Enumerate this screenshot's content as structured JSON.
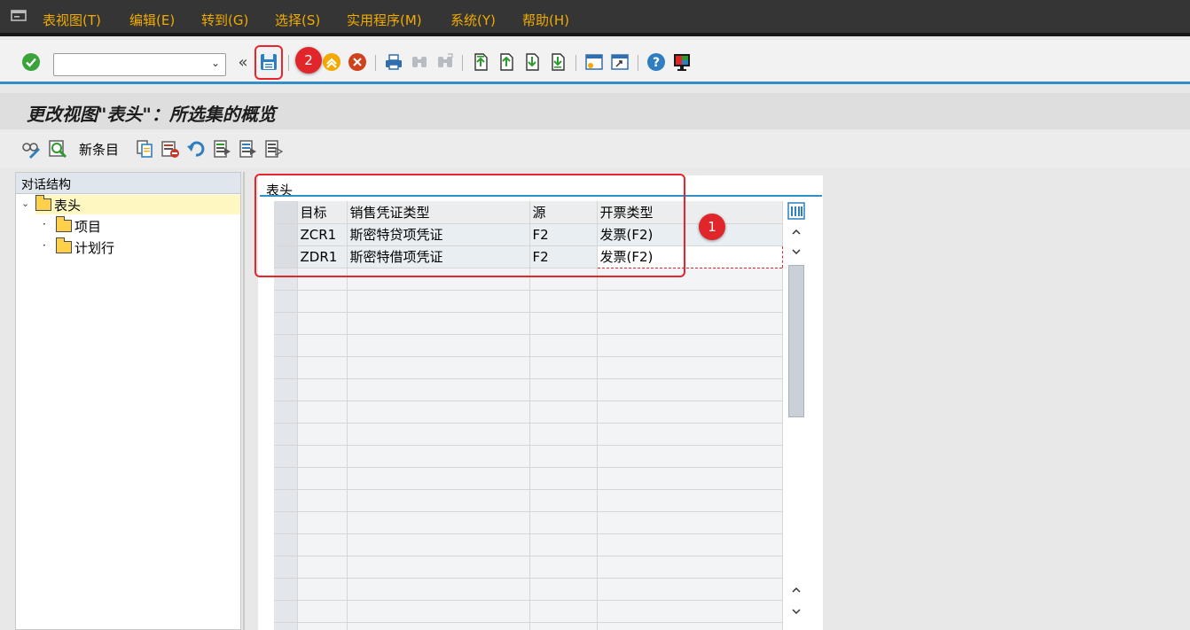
{
  "menubar": {
    "items": [
      "表视图(T)",
      "编辑(E)",
      "转到(G)",
      "选择(S)",
      "实用程序(M)",
      "系统(Y)",
      "帮助(H)"
    ]
  },
  "toolbar": {
    "command_field_value": "",
    "icons": [
      "enter-check-icon",
      "command-field",
      "expand-collapse-icon",
      "save-icon",
      "back-icon",
      "exit-icon",
      "cancel-icon",
      "print-icon",
      "find-icon",
      "find-next-icon",
      "first-page-icon",
      "prev-page-icon",
      "next-page-icon",
      "last-page-icon",
      "new-session-icon",
      "shortcut-icon",
      "help-icon",
      "customize-layout-icon"
    ]
  },
  "title": "更改视图\"表头\"：所选集的概览",
  "app_toolbar": {
    "new_entry_label": "新条目"
  },
  "tree": {
    "header": "对话结构",
    "nodes": [
      {
        "label": "表头",
        "selected": true
      },
      {
        "label": "项目",
        "selected": false
      },
      {
        "label": "计划行",
        "selected": false
      }
    ]
  },
  "panel": {
    "title": "表头",
    "columns": [
      "目标",
      "销售凭证类型",
      "源",
      "开票类型"
    ],
    "rows": [
      [
        "ZCR1",
        "斯密特贷项凭证",
        "F2",
        "发票(F2)"
      ],
      [
        "ZDR1",
        "斯密特借项凭证",
        "F2",
        "发票(F2)"
      ]
    ]
  },
  "annotations": {
    "marker_1": "1",
    "marker_2": "2",
    "color": "#e8252c"
  },
  "colors": {
    "menubar_bg": "#353535",
    "menu_text": "#f0ab00",
    "accent_blue": "#2f8fc6",
    "tree_selected": "#fff7c2"
  }
}
